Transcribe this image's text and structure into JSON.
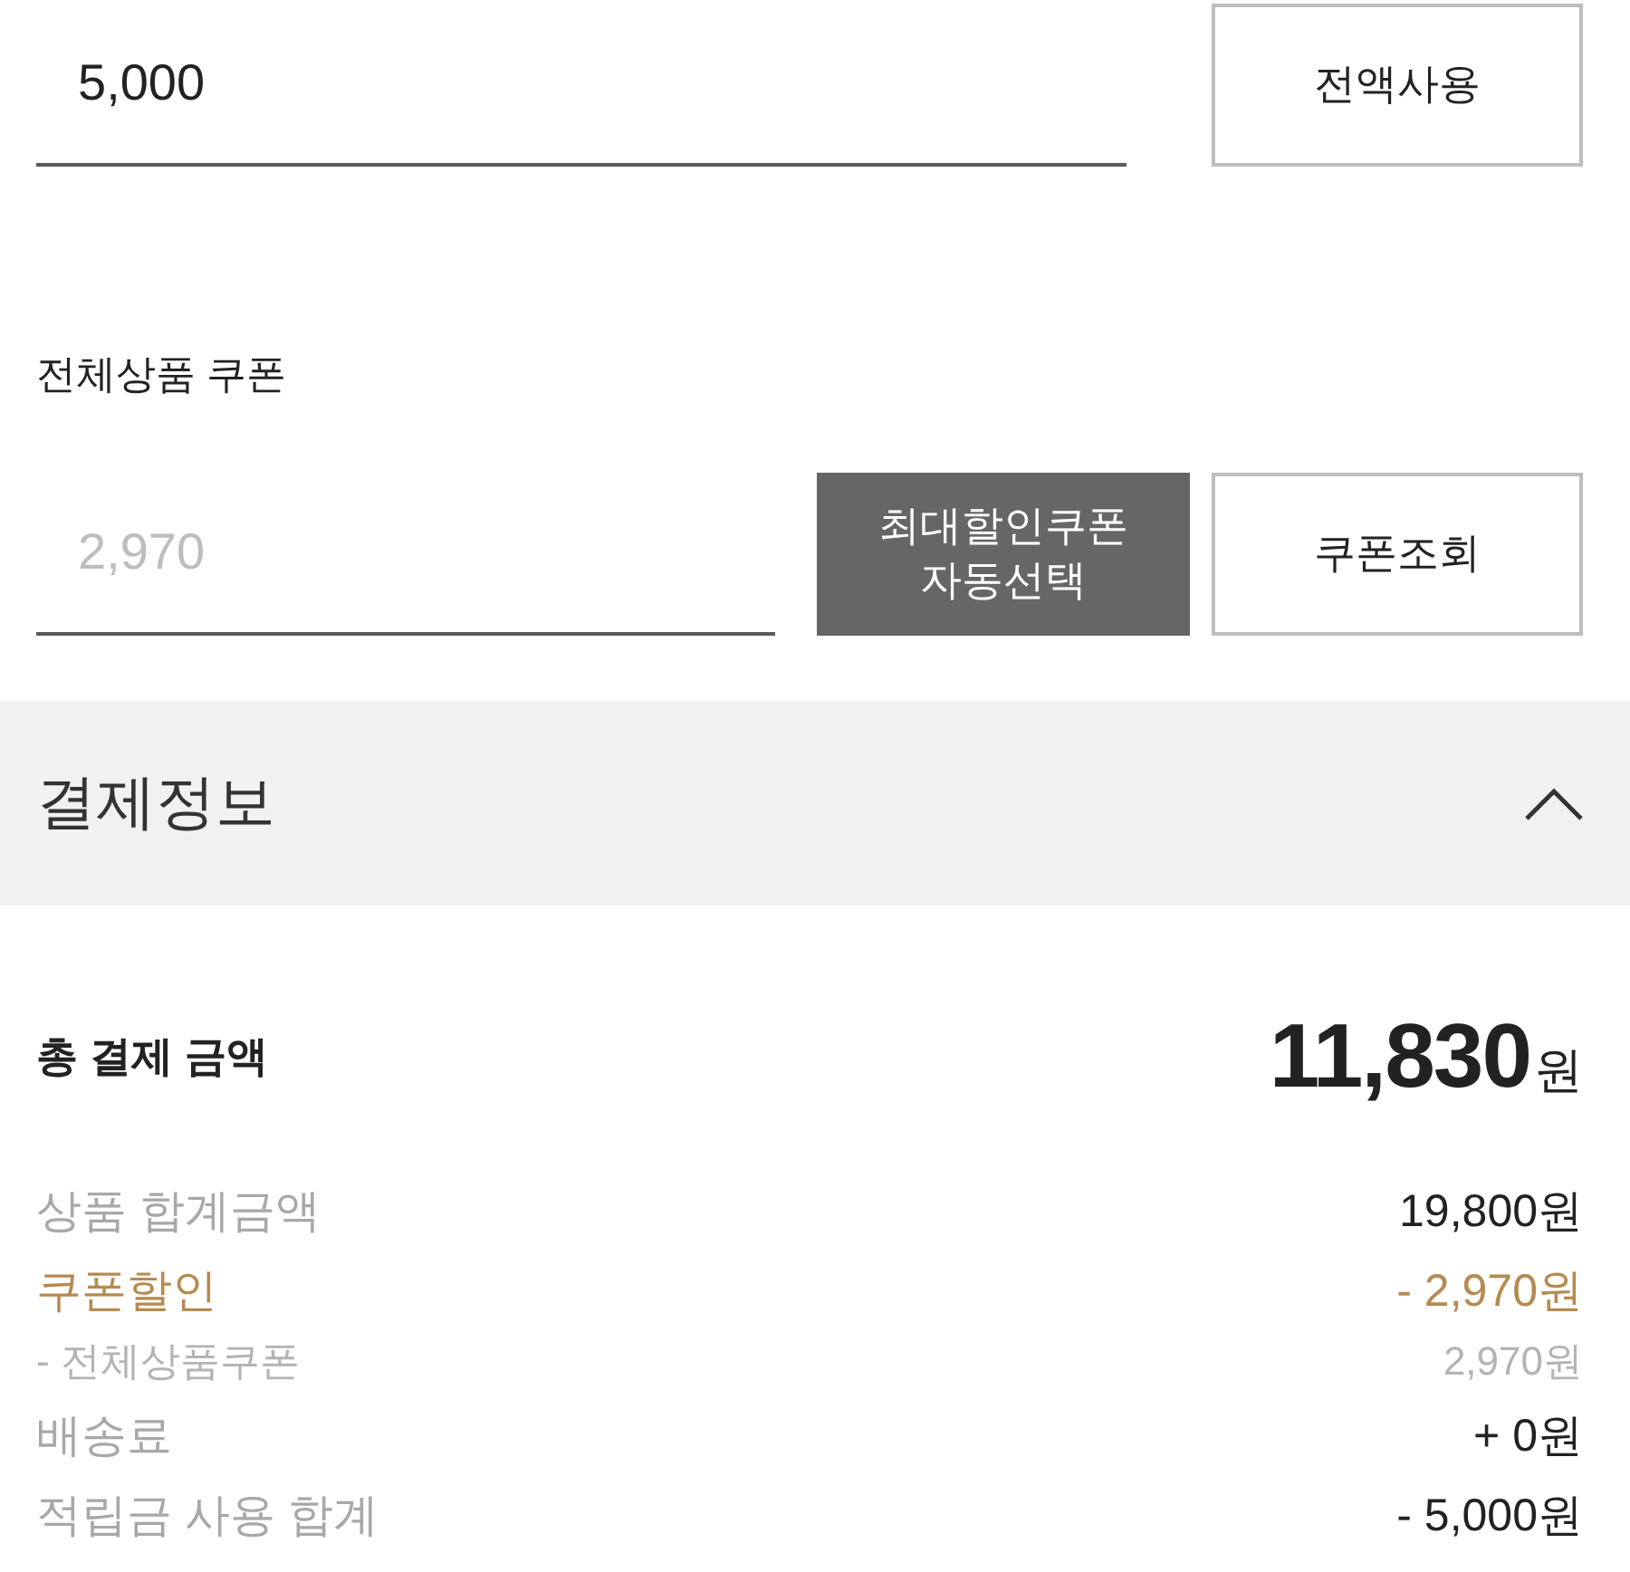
{
  "points_field": {
    "value": "5,000"
  },
  "use_all_button": {
    "label": "전액사용"
  },
  "coupon": {
    "label": "전체상품 쿠폰",
    "field": {
      "placeholder": "2,970"
    },
    "auto_button": {
      "label": "최대할인쿠폰 자동선택"
    },
    "lookup_button": {
      "label": "쿠폰조회"
    }
  },
  "payment": {
    "title": "결제정보",
    "expanded": true,
    "total": {
      "label": "총 결제 금액",
      "amount": "11,830",
      "unit": "원"
    },
    "rows": [
      {
        "kind": "item",
        "label": "상품 합계금액",
        "value": "19,800원"
      },
      {
        "kind": "discount",
        "label": "쿠폰할인",
        "value": "- 2,970원"
      },
      {
        "kind": "sub",
        "label": "- 전체상품쿠폰",
        "value": "2,970원"
      },
      {
        "kind": "item",
        "label": "배송료",
        "value": "+ 0원"
      },
      {
        "kind": "item",
        "label": "적립금 사용 합계",
        "value": "- 5,000원"
      }
    ]
  }
}
